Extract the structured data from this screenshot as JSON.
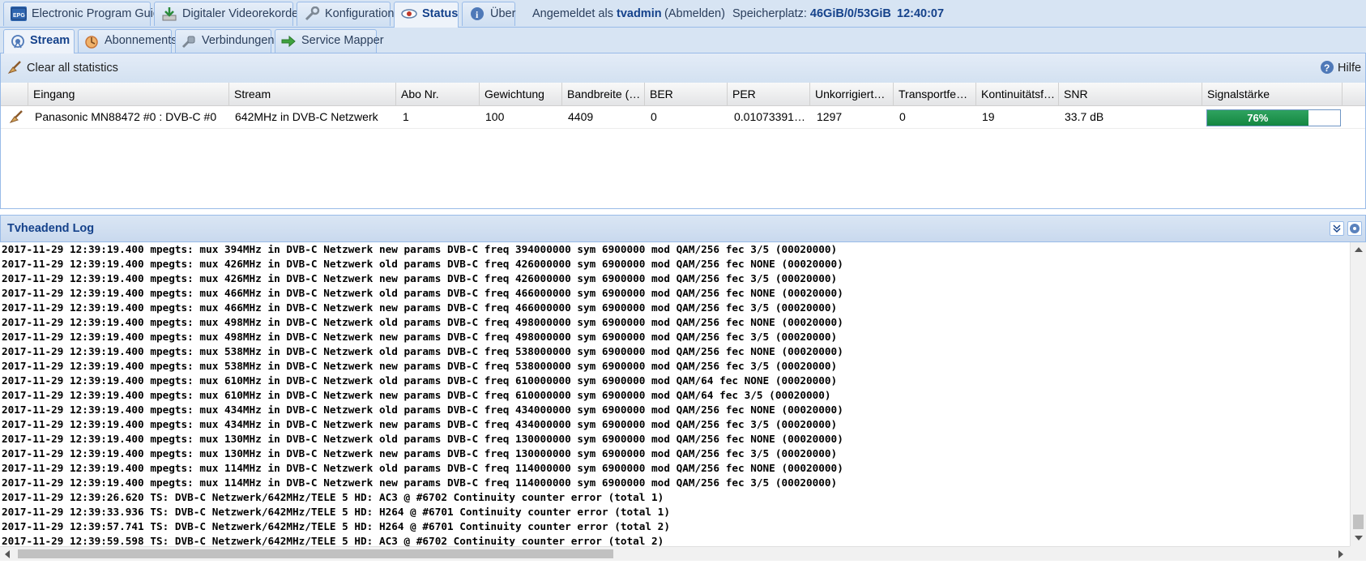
{
  "top_tabs": [
    {
      "label": "Electronic Program Guide",
      "icon": "epg-icon"
    },
    {
      "label": "Digitaler Videorekorder",
      "icon": "download-icon"
    },
    {
      "label": "Konfiguration",
      "icon": "wrench-icon"
    },
    {
      "label": "Status",
      "icon": "eye-icon",
      "active": true
    },
    {
      "label": "Über",
      "icon": "info-icon"
    }
  ],
  "session": {
    "logged_in_prefix": "Angemeldet als",
    "user": "tvadmin",
    "logout": "(Abmelden)",
    "storage_label": "Speicherplatz:",
    "storage_value": "46GiB/0/53GiB",
    "clock": "12:40:07"
  },
  "sub_tabs": [
    {
      "label": "Stream",
      "icon": "antenna-icon",
      "active": true
    },
    {
      "label": "Abonnements",
      "icon": "subscription-icon"
    },
    {
      "label": "Verbindungen",
      "icon": "plug-icon"
    },
    {
      "label": "Service Mapper",
      "icon": "arrow-right-icon"
    }
  ],
  "toolbar": {
    "clear_label": "Clear all statistics",
    "help_label": "Hilfe"
  },
  "grid": {
    "columns": [
      "Eingang",
      "Stream",
      "Abo Nr.",
      "Gewichtung",
      "Bandbreite (…",
      "BER",
      "PER",
      "Unkorrigiert…",
      "Transportfe…",
      "Kontinuitätsf…",
      "SNR",
      "Signalstärke"
    ],
    "rows": [
      {
        "eingang": "Panasonic MN88472 #0 : DVB-C #0",
        "stream": "642MHz in DVB-C Netzwerk",
        "abo": "1",
        "gewichtung": "100",
        "bandbreite": "4409",
        "ber": "0",
        "per": "0.01073391…",
        "unkorrigiert": "1297",
        "transport": "0",
        "kontinuitaet": "19",
        "snr": "33.7 dB",
        "signal_label": "76%",
        "signal_fraction": 0.76
      }
    ]
  },
  "log": {
    "title": "Tvheadend Log",
    "lines": [
      "2017-11-29 12:39:19.400 mpegts: mux 394MHz in DVB-C Netzwerk new params DVB-C freq 394000000 sym 6900000 mod QAM/256 fec 3/5 (00020000)",
      "2017-11-29 12:39:19.400 mpegts: mux 426MHz in DVB-C Netzwerk old params DVB-C freq 426000000 sym 6900000 mod QAM/256 fec NONE (00020000)",
      "2017-11-29 12:39:19.400 mpegts: mux 426MHz in DVB-C Netzwerk new params DVB-C freq 426000000 sym 6900000 mod QAM/256 fec 3/5 (00020000)",
      "2017-11-29 12:39:19.400 mpegts: mux 466MHz in DVB-C Netzwerk old params DVB-C freq 466000000 sym 6900000 mod QAM/256 fec NONE (00020000)",
      "2017-11-29 12:39:19.400 mpegts: mux 466MHz in DVB-C Netzwerk new params DVB-C freq 466000000 sym 6900000 mod QAM/256 fec 3/5 (00020000)",
      "2017-11-29 12:39:19.400 mpegts: mux 498MHz in DVB-C Netzwerk old params DVB-C freq 498000000 sym 6900000 mod QAM/256 fec NONE (00020000)",
      "2017-11-29 12:39:19.400 mpegts: mux 498MHz in DVB-C Netzwerk new params DVB-C freq 498000000 sym 6900000 mod QAM/256 fec 3/5 (00020000)",
      "2017-11-29 12:39:19.400 mpegts: mux 538MHz in DVB-C Netzwerk old params DVB-C freq 538000000 sym 6900000 mod QAM/256 fec NONE (00020000)",
      "2017-11-29 12:39:19.400 mpegts: mux 538MHz in DVB-C Netzwerk new params DVB-C freq 538000000 sym 6900000 mod QAM/256 fec 3/5 (00020000)",
      "2017-11-29 12:39:19.400 mpegts: mux 610MHz in DVB-C Netzwerk old params DVB-C freq 610000000 sym 6900000 mod QAM/64 fec NONE (00020000)",
      "2017-11-29 12:39:19.400 mpegts: mux 610MHz in DVB-C Netzwerk new params DVB-C freq 610000000 sym 6900000 mod QAM/64 fec 3/5 (00020000)",
      "2017-11-29 12:39:19.400 mpegts: mux 434MHz in DVB-C Netzwerk old params DVB-C freq 434000000 sym 6900000 mod QAM/256 fec NONE (00020000)",
      "2017-11-29 12:39:19.400 mpegts: mux 434MHz in DVB-C Netzwerk new params DVB-C freq 434000000 sym 6900000 mod QAM/256 fec 3/5 (00020000)",
      "2017-11-29 12:39:19.400 mpegts: mux 130MHz in DVB-C Netzwerk old params DVB-C freq 130000000 sym 6900000 mod QAM/256 fec NONE (00020000)",
      "2017-11-29 12:39:19.400 mpegts: mux 130MHz in DVB-C Netzwerk new params DVB-C freq 130000000 sym 6900000 mod QAM/256 fec 3/5 (00020000)",
      "2017-11-29 12:39:19.400 mpegts: mux 114MHz in DVB-C Netzwerk old params DVB-C freq 114000000 sym 6900000 mod QAM/256 fec NONE (00020000)",
      "2017-11-29 12:39:19.400 mpegts: mux 114MHz in DVB-C Netzwerk new params DVB-C freq 114000000 sym 6900000 mod QAM/256 fec 3/5 (00020000)",
      "2017-11-29 12:39:26.620 TS: DVB-C Netzwerk/642MHz/TELE 5 HD: AC3 @ #6702 Continuity counter error (total 1)",
      "2017-11-29 12:39:33.936 TS: DVB-C Netzwerk/642MHz/TELE 5 HD: H264 @ #6701 Continuity counter error (total 1)",
      "2017-11-29 12:39:57.741 TS: DVB-C Netzwerk/642MHz/TELE 5 HD: H264 @ #6701 Continuity counter error (total 2)",
      "2017-11-29 12:39:59.598 TS: DVB-C Netzwerk/642MHz/TELE 5 HD: AC3 @ #6702 Continuity counter error (total 2)"
    ]
  },
  "colors": {
    "accent": "#15428b",
    "signal_fill": "#1a8f4a",
    "panel_bg": "#d7e4f3"
  }
}
